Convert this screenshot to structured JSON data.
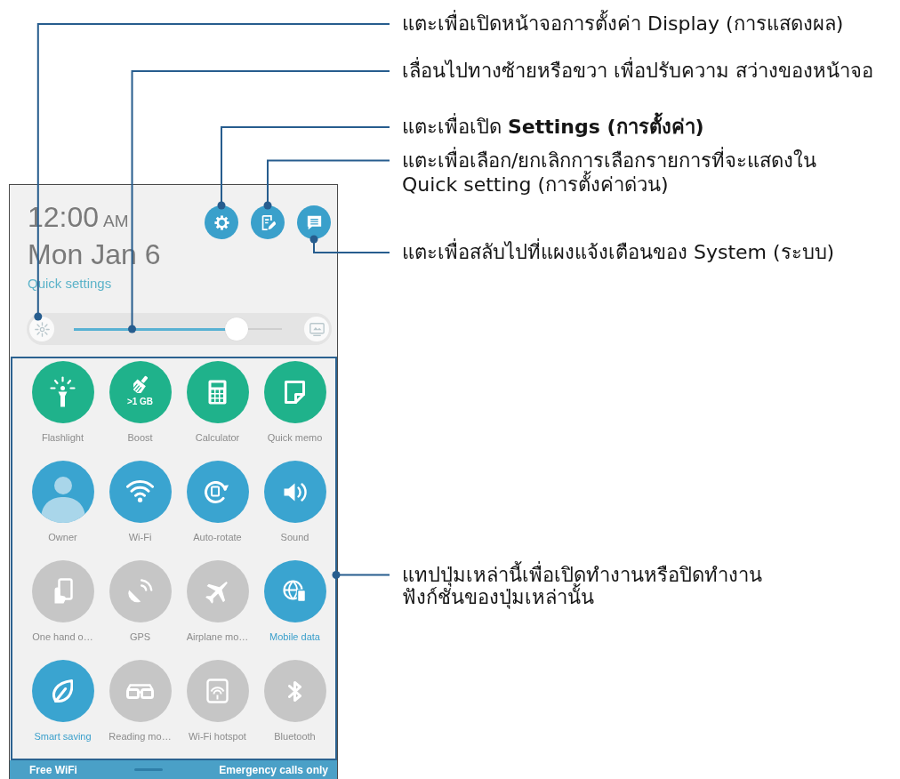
{
  "panel": {
    "time": "12:00",
    "meridiem": "AM",
    "date": "Mon Jan 6",
    "section_title": "Quick settings"
  },
  "brightness": {
    "level": 0.78
  },
  "tile_rows": [
    [
      {
        "label": "Flashlight",
        "kind": "shortcut",
        "on": true,
        "highlighted": false
      },
      {
        "label": "Boost",
        "kind": "shortcut",
        "on": true,
        "highlighted": false,
        "badge": ">1 GB"
      },
      {
        "label": "Calculator",
        "kind": "shortcut",
        "on": true,
        "highlighted": false
      },
      {
        "label": "Quick memo",
        "kind": "shortcut",
        "on": true,
        "highlighted": false
      }
    ],
    [
      {
        "label": "Owner",
        "kind": "profile",
        "on": true,
        "highlighted": false
      },
      {
        "label": "Wi-Fi",
        "kind": "toggle",
        "on": true,
        "highlighted": false
      },
      {
        "label": "Auto-rotate",
        "kind": "toggle",
        "on": true,
        "highlighted": false
      },
      {
        "label": "Sound",
        "kind": "toggle",
        "on": true,
        "highlighted": false
      }
    ],
    [
      {
        "label": "One hand o…",
        "kind": "toggle",
        "on": false,
        "highlighted": false
      },
      {
        "label": "GPS",
        "kind": "toggle",
        "on": false,
        "highlighted": false
      },
      {
        "label": "Airplane mo…",
        "kind": "toggle",
        "on": false,
        "highlighted": false
      },
      {
        "label": "Mobile data",
        "kind": "toggle",
        "on": true,
        "highlighted": true
      }
    ],
    [
      {
        "label": "Smart saving",
        "kind": "toggle",
        "on": true,
        "highlighted": true
      },
      {
        "label": "Reading mo…",
        "kind": "toggle",
        "on": false,
        "highlighted": false
      },
      {
        "label": "Wi-Fi hotspot",
        "kind": "toggle",
        "on": false,
        "highlighted": false
      },
      {
        "label": "Bluetooth",
        "kind": "toggle",
        "on": false,
        "highlighted": false
      }
    ]
  ],
  "status_bar": {
    "network": "Free WiFi",
    "status": "Emergency calls only"
  },
  "callouts": [
    {
      "lines": [
        "แตะเพื่อเปิดหน้าจอการตั้งค่า Display (การแสดงผล)"
      ]
    },
    {
      "lines": [
        "เลื่อนไปทางซ้ายหรือขวา เพื่อปรับความ สว่างของหน้าจอ"
      ]
    },
    {
      "lines": [
        "แตะเพื่อเปิด **Settings (การตั้งค่า)**"
      ]
    },
    {
      "lines": [
        "แตะเพื่อเลือก/ยกเลิกการเลือกรายการที่จะแสดงใน",
        "Quick setting (การตั้งค่าด่วน)"
      ]
    },
    {
      "lines": [
        "แตะเพื่อสลับไปที่แผงแจ้งเตือนของ System (ระบบ)"
      ]
    },
    {
      "lines": [
        "แทปปุ่มเหล่านี้เพื่อเปิดทำงานหรือปิดทำงาน",
        "ฟังก์ชันของปุ่มเหล่านั้น"
      ]
    }
  ]
}
